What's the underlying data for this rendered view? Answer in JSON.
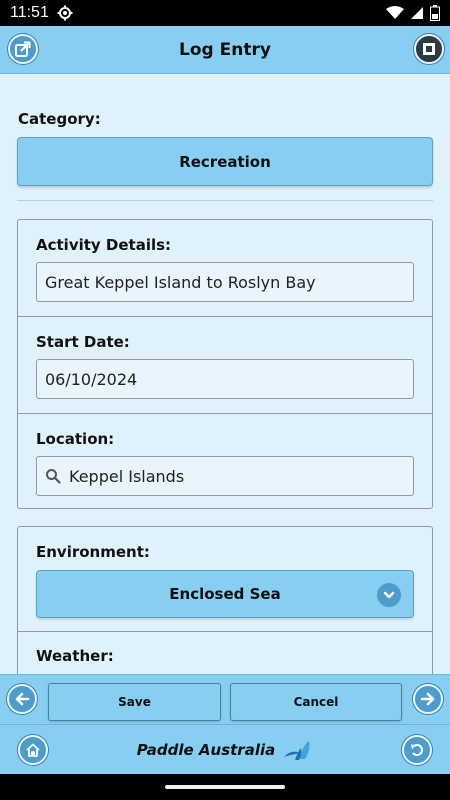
{
  "status": {
    "time": "11:51"
  },
  "header": {
    "title": "Log Entry"
  },
  "category": {
    "label": "Category:",
    "value": "Recreation"
  },
  "activity": {
    "label": "Activity Details:",
    "value": "Great Keppel Island to Roslyn Bay"
  },
  "start_date": {
    "label": "Start Date:",
    "value": "06/10/2024"
  },
  "location": {
    "label": "Location:",
    "value": "Keppel Islands"
  },
  "environment": {
    "label": "Environment:",
    "value": "Enclosed Sea"
  },
  "weather": {
    "label": "Weather:"
  },
  "actions": {
    "save": "Save",
    "cancel": "Cancel"
  },
  "footer": {
    "brand": "Paddle Australia"
  },
  "icons": {
    "status": [
      "gear-icon",
      "wifi-icon",
      "signal-icon",
      "battery-icon"
    ],
    "header_left": "share-icon",
    "header_right": "stop-icon",
    "prev": "arrow-left-icon",
    "next": "arrow-right-icon",
    "home": "home-icon",
    "back": "undo-icon",
    "location": "search-icon",
    "environment": "chevron-down-icon",
    "brand": "paddle-logo-icon"
  },
  "colors": {
    "accent": "#87cef1",
    "background": "#dff1fb",
    "button_dark": "#4e9ccc"
  }
}
